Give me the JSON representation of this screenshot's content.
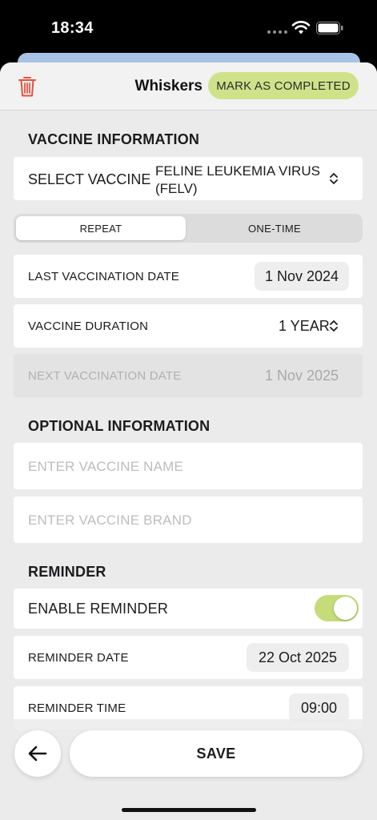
{
  "status_bar": {
    "time": "18:34"
  },
  "header": {
    "pet_name": "Whiskers",
    "mark_completed_label": "MARK AS COMPLETED"
  },
  "vaccine_info": {
    "title": "VACCINE INFORMATION",
    "select_label": "SELECT VACCINE",
    "selected_vaccine_line1": "FELINE LEUKEMIA VIRUS",
    "selected_vaccine_line2": "(FELV)",
    "segments": [
      "REPEAT",
      "ONE-TIME"
    ],
    "last_date_label": "LAST VACCINATION DATE",
    "last_date_value": "1 Nov 2024",
    "duration_label": "VACCINE DURATION",
    "duration_value": "1 YEAR",
    "next_date_label": "NEXT VACCINATION DATE",
    "next_date_value": "1 Nov 2025"
  },
  "optional_info": {
    "title": "OPTIONAL INFORMATION",
    "name_placeholder": "ENTER VACCINE NAME",
    "brand_placeholder": "ENTER VACCINE BRAND"
  },
  "reminder": {
    "title": "REMINDER",
    "enable_label": "ENABLE REMINDER",
    "enabled": true,
    "date_label": "REMINDER DATE",
    "date_value": "22 Oct 2025",
    "time_label": "REMINDER TIME",
    "time_value": "09:00"
  },
  "footer": {
    "save_label": "SAVE"
  },
  "colors": {
    "accent": "#cfe289",
    "toggle_on": "#c6dc7a",
    "delete": "#e0533f"
  }
}
